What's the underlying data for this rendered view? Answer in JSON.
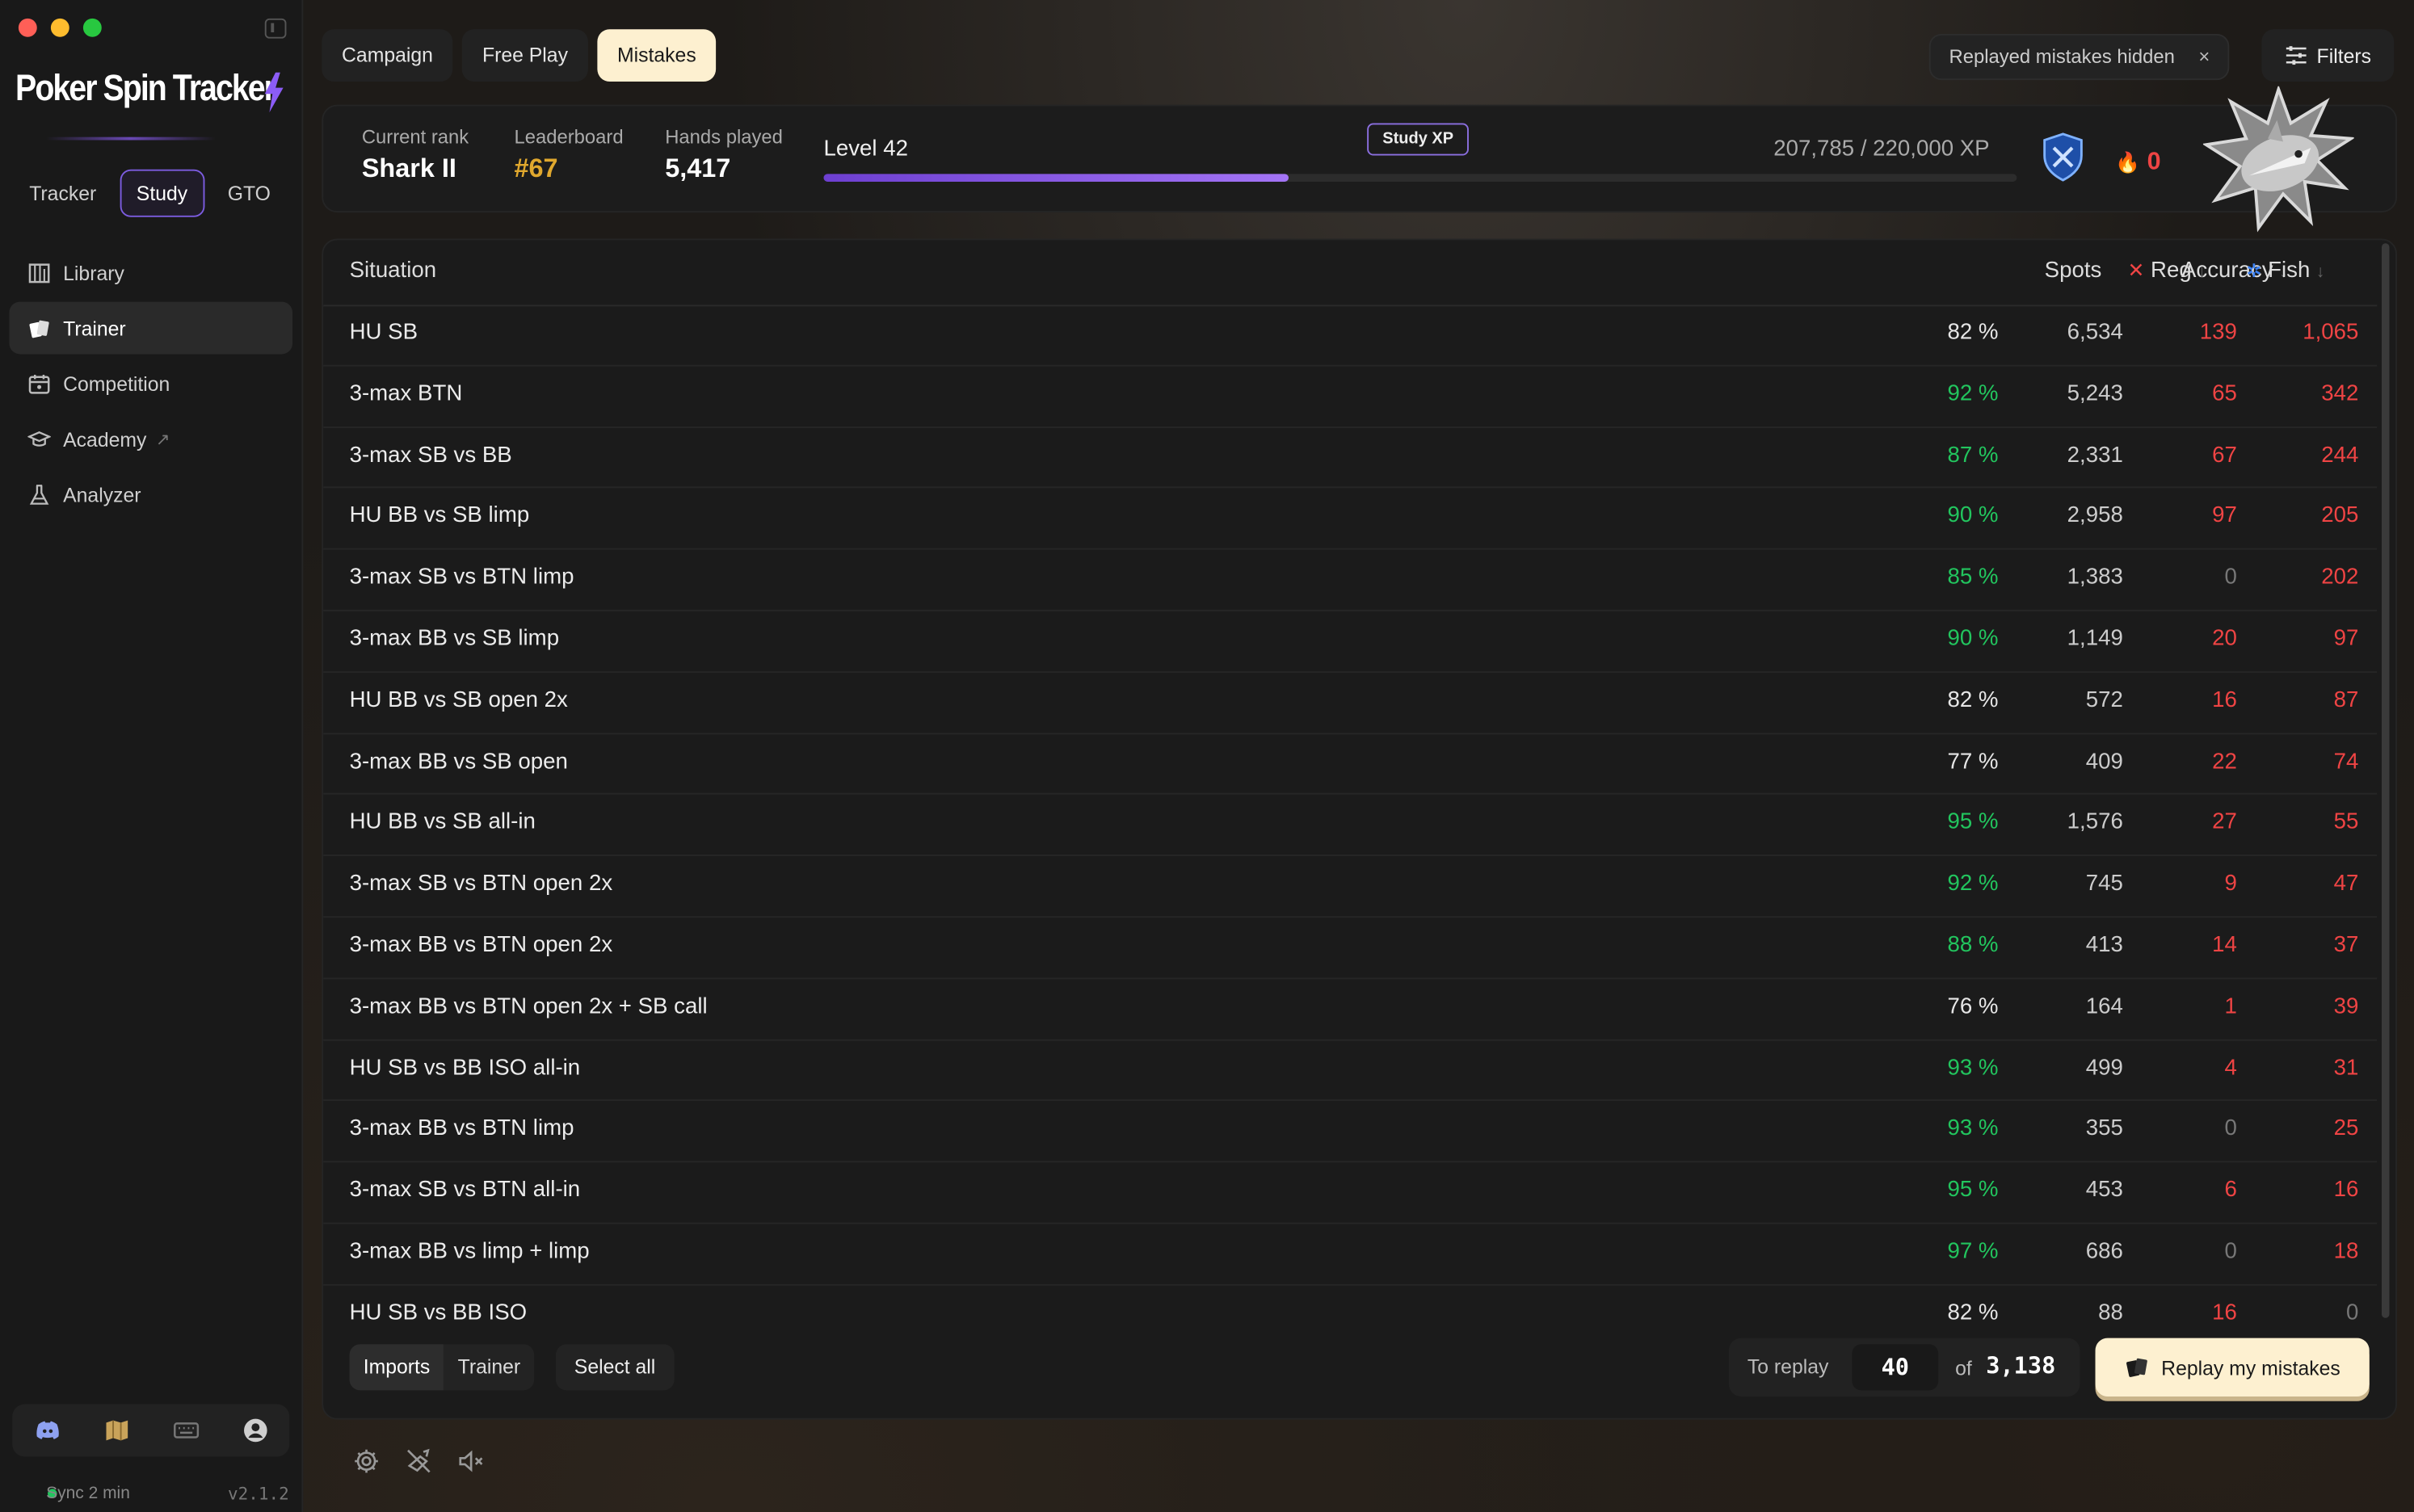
{
  "app": {
    "brand": "Poker Spin Tracker",
    "colors": {
      "accent": "#8b5cf6",
      "cream": "#fdf0d0",
      "positive": "#22c55e",
      "negative": "#ef4444",
      "gold": "#e0a82e"
    }
  },
  "sidebar": {
    "modes": [
      "Tracker",
      "Study",
      "GTO"
    ],
    "active_mode": "Study",
    "nav": [
      {
        "label": "Library",
        "icon": "library-icon"
      },
      {
        "label": "Trainer",
        "icon": "cards-icon",
        "active": true
      },
      {
        "label": "Competition",
        "icon": "competition-icon"
      },
      {
        "label": "Academy",
        "icon": "academy-icon",
        "external": true
      },
      {
        "label": "Analyzer",
        "icon": "flask-icon"
      }
    ],
    "bottom_icons": [
      "discord-icon",
      "map-icon",
      "keyboard-icon",
      "account-icon"
    ],
    "sync": "Sync 2 min",
    "version": "v2.1.2"
  },
  "tabs": [
    "Campaign",
    "Free Play",
    "Mistakes"
  ],
  "active_tab": "Mistakes",
  "filter_chip": {
    "label": "Replayed mistakes hidden",
    "close": "×"
  },
  "filters_button": "Filters",
  "stats": {
    "rank_label": "Current rank",
    "rank_value": "Shark II",
    "leaderboard_label": "Leaderboard",
    "leaderboard_value": "#67",
    "hands_label": "Hands played",
    "hands_value": "5,417",
    "level": "Level 42",
    "xp_badge": "Study XP",
    "xp_text": "207,785 / 220,000 XP",
    "xp_progress": 0.39,
    "streak": "0"
  },
  "table": {
    "columns": {
      "situation": "Situation",
      "accuracy": "Accuracy",
      "spots": "Spots",
      "reg": "Reg",
      "fish": "Fish"
    },
    "rows": [
      {
        "situation": "HU SB",
        "accuracy": "82 %",
        "acc_color": "white",
        "spots": "6,534",
        "reg": "139",
        "fish": "1,065"
      },
      {
        "situation": "3-max BTN",
        "accuracy": "92 %",
        "acc_color": "green",
        "spots": "5,243",
        "reg": "65",
        "fish": "342"
      },
      {
        "situation": "3-max SB vs BB",
        "accuracy": "87 %",
        "acc_color": "green",
        "spots": "2,331",
        "reg": "67",
        "fish": "244"
      },
      {
        "situation": "HU BB vs SB limp",
        "accuracy": "90 %",
        "acc_color": "green",
        "spots": "2,958",
        "reg": "97",
        "fish": "205"
      },
      {
        "situation": "3-max SB vs BTN limp",
        "accuracy": "85 %",
        "acc_color": "green",
        "spots": "1,383",
        "reg": "0",
        "fish": "202"
      },
      {
        "situation": "3-max BB vs SB limp",
        "accuracy": "90 %",
        "acc_color": "green",
        "spots": "1,149",
        "reg": "20",
        "fish": "97"
      },
      {
        "situation": "HU BB vs SB open 2x",
        "accuracy": "82 %",
        "acc_color": "white",
        "spots": "572",
        "reg": "16",
        "fish": "87"
      },
      {
        "situation": "3-max BB vs SB open",
        "accuracy": "77 %",
        "acc_color": "white",
        "spots": "409",
        "reg": "22",
        "fish": "74"
      },
      {
        "situation": "HU BB vs SB all-in",
        "accuracy": "95 %",
        "acc_color": "green",
        "spots": "1,576",
        "reg": "27",
        "fish": "55"
      },
      {
        "situation": "3-max SB vs BTN open 2x",
        "accuracy": "92 %",
        "acc_color": "green",
        "spots": "745",
        "reg": "9",
        "fish": "47"
      },
      {
        "situation": "3-max BB vs BTN open 2x",
        "accuracy": "88 %",
        "acc_color": "green",
        "spots": "413",
        "reg": "14",
        "fish": "37"
      },
      {
        "situation": "3-max BB vs BTN open 2x + SB call",
        "accuracy": "76 %",
        "acc_color": "white",
        "spots": "164",
        "reg": "1",
        "fish": "39"
      },
      {
        "situation": "HU SB vs BB ISO all-in",
        "accuracy": "93 %",
        "acc_color": "green",
        "spots": "499",
        "reg": "4",
        "fish": "31"
      },
      {
        "situation": "3-max BB vs BTN limp",
        "accuracy": "93 %",
        "acc_color": "green",
        "spots": "355",
        "reg": "0",
        "fish": "25"
      },
      {
        "situation": "3-max SB vs BTN all-in",
        "accuracy": "95 %",
        "acc_color": "green",
        "spots": "453",
        "reg": "6",
        "fish": "16"
      },
      {
        "situation": "3-max BB vs limp + limp",
        "accuracy": "97 %",
        "acc_color": "green",
        "spots": "686",
        "reg": "0",
        "fish": "18"
      },
      {
        "situation": "HU SB vs BB ISO",
        "accuracy": "82 %",
        "acc_color": "white",
        "spots": "88",
        "reg": "16",
        "fish": "0"
      }
    ]
  },
  "footer": {
    "source_options": [
      "Imports",
      "Trainer"
    ],
    "active_source": "Imports",
    "select_all": "Select all",
    "to_replay_label": "To replay",
    "to_replay_value": "40",
    "of_label": "of",
    "total": "3,138",
    "replay_button": "Replay my mistakes"
  },
  "bottom_toolbar": [
    "settings-icon",
    "sound-mode-icon",
    "mute-icon"
  ]
}
